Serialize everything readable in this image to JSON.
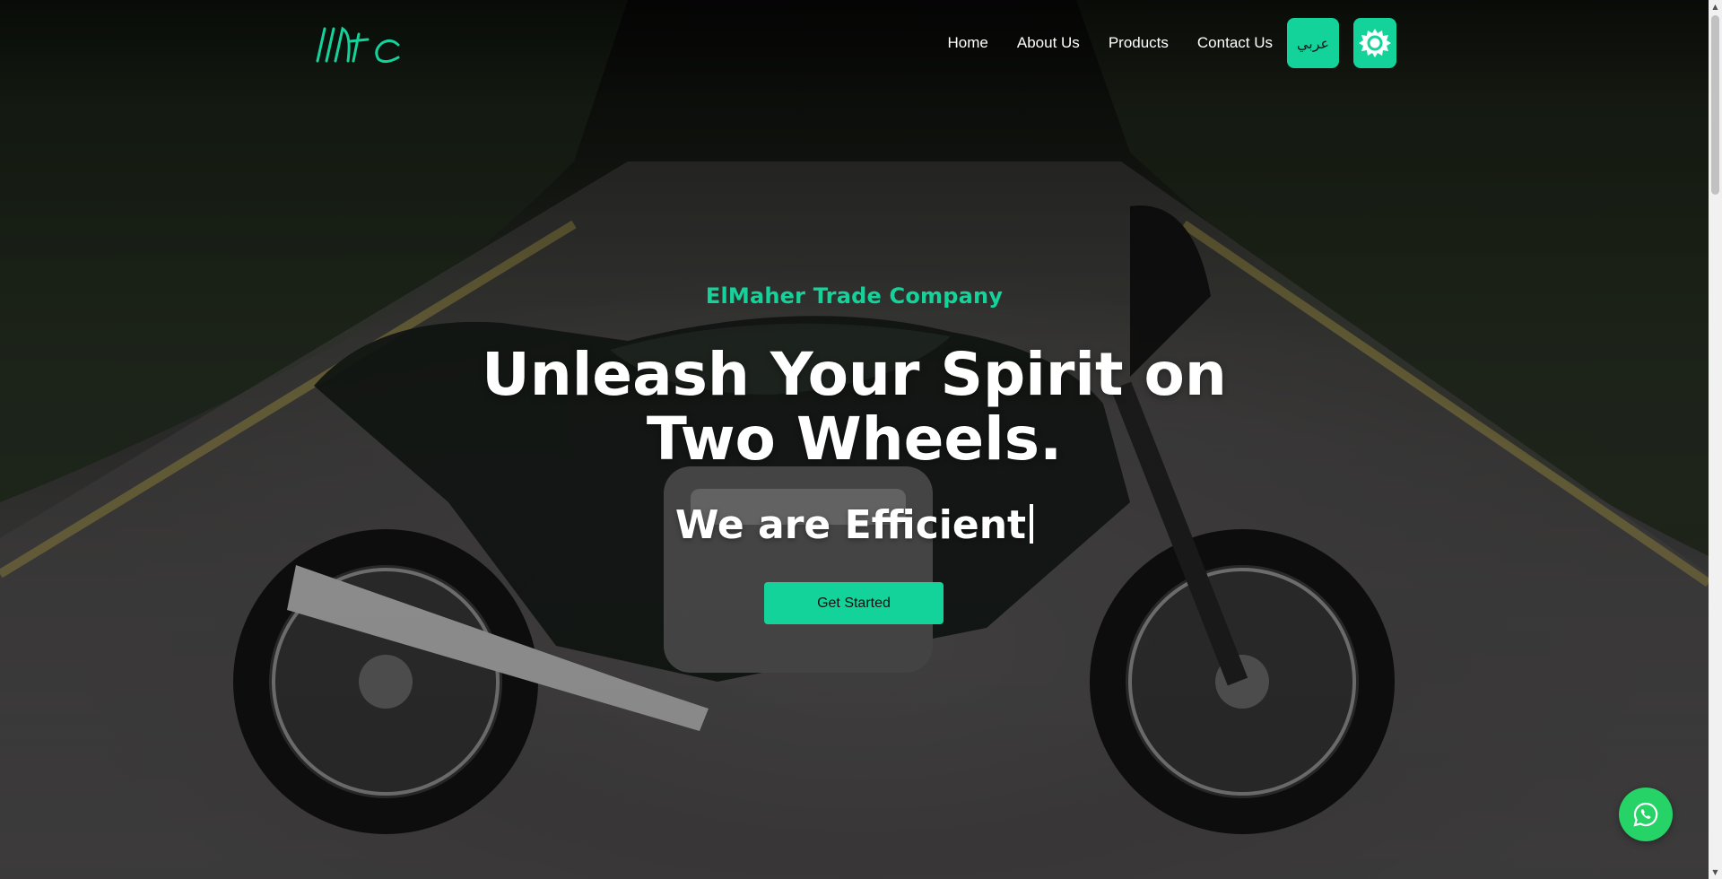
{
  "brand": {
    "logo_text": "Mtc",
    "accent_color": "#14d39a"
  },
  "nav": {
    "items": [
      {
        "label": "Home"
      },
      {
        "label": "About Us"
      },
      {
        "label": "Products"
      },
      {
        "label": "Contact Us"
      }
    ],
    "language_button": "عربي",
    "theme_toggle_icon": "sun-icon"
  },
  "hero": {
    "company": "ElMaher Trade Company",
    "headline_line1": "Unleash Your Spirit on",
    "headline_line2": "Two Wheels.",
    "typed_prefix": "We are",
    "typed_word": "Efficient",
    "cta_label": "Get Started",
    "background": "motorcycle-photo"
  },
  "floating": {
    "whatsapp_icon": "whatsapp-icon",
    "whatsapp_color": "#25d366"
  }
}
